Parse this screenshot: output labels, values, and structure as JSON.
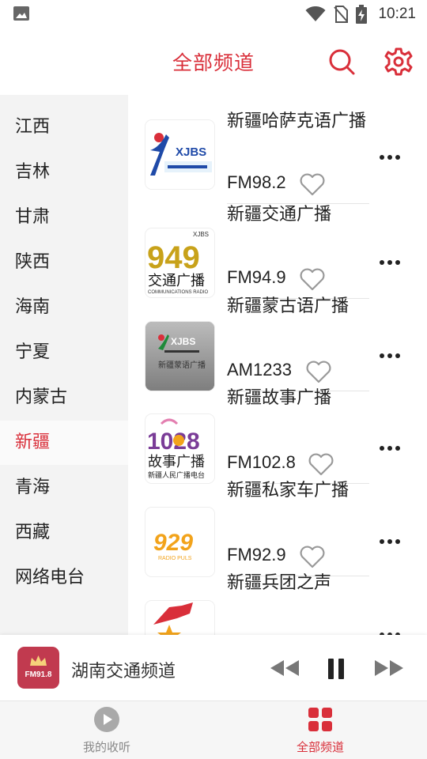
{
  "status_bar": {
    "time": "10:21",
    "icons": [
      "image-icon",
      "wifi-icon",
      "no-sim-icon",
      "battery-charging-icon"
    ]
  },
  "header": {
    "title": "全部频道",
    "icons": [
      "search-icon",
      "gear-icon"
    ]
  },
  "sidebar": {
    "selected": "新疆",
    "items": [
      {
        "label": "江西"
      },
      {
        "label": "吉林"
      },
      {
        "label": "甘肃"
      },
      {
        "label": "陕西"
      },
      {
        "label": "海南"
      },
      {
        "label": "宁夏"
      },
      {
        "label": "内蒙古"
      },
      {
        "label": "新疆"
      },
      {
        "label": "青海"
      },
      {
        "label": "西藏"
      },
      {
        "label": "网络电台"
      }
    ]
  },
  "channels": [
    {
      "name": "新疆哈萨克语广播",
      "freq": "FM98.2",
      "logo_text": "XJBS"
    },
    {
      "name": "新疆交通广播",
      "freq": "FM94.9",
      "logo_text": "949",
      "logo_sub": "交通广播",
      "logo_caption": "COMMUNICATIONS RADIO",
      "logo_brand": "XJBS"
    },
    {
      "name": "新疆蒙古语广播",
      "freq": "AM1233",
      "logo_text": "XJBS",
      "logo_sub": "新疆蒙语广播"
    },
    {
      "name": "新疆故事广播",
      "freq": "FM102.8",
      "logo_text": "1028",
      "logo_sub": "故事广播",
      "logo_caption": "新疆人民广播电台"
    },
    {
      "name": "新疆私家车广播",
      "freq": "FM92.9",
      "logo_text": "929",
      "logo_caption": "RADIO PULS"
    },
    {
      "name": "新疆兵团之声",
      "freq": ""
    }
  ],
  "player": {
    "now_playing": "湖南交通频道",
    "cover_text": "FM91.8",
    "controls": [
      "previous-icon",
      "pause-icon",
      "next-icon"
    ]
  },
  "tabs": [
    {
      "label": "我的收听",
      "icon": "play-circle-icon",
      "active": false
    },
    {
      "label": "全部频道",
      "icon": "grid-icon",
      "active": true
    }
  ],
  "colors": {
    "accent": "#d92f3a",
    "sidebar_bg": "#f3f3f3",
    "icon_gray": "#8a8a8a"
  }
}
